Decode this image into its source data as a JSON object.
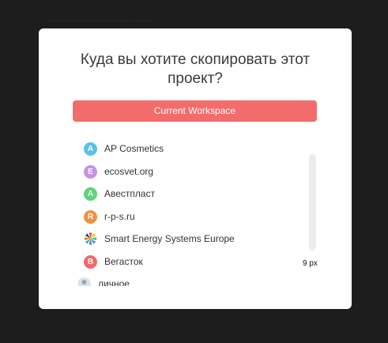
{
  "background": {
    "text": "... ... ... ... ... ... ... ... ... ... ... ..."
  },
  "modal": {
    "title": "Куда вы хотите скопировать этот проект?",
    "primary_button": "Current Workspace",
    "scroll_tip": "9 px"
  },
  "workspaces": [
    {
      "initial": "A",
      "name": "AP Cosmetics",
      "color": "#5bc0eb"
    },
    {
      "initial": "E",
      "name": "ecosvet.org",
      "color": "#c592e6"
    },
    {
      "initial": "A",
      "name": "Авестпласт",
      "color": "#5fd27a"
    },
    {
      "initial": "R",
      "name": "r-p-s.ru",
      "color": "#f0913e"
    },
    {
      "initial": "",
      "name": "Smart Energy Systems Europe",
      "icon": "pinwheel-logo-icon"
    },
    {
      "initial": "B",
      "name": "Вегасток",
      "color": "#f16a6a"
    },
    {
      "initial": "",
      "name": "личное",
      "icon": "personal-avatar-icon"
    }
  ]
}
